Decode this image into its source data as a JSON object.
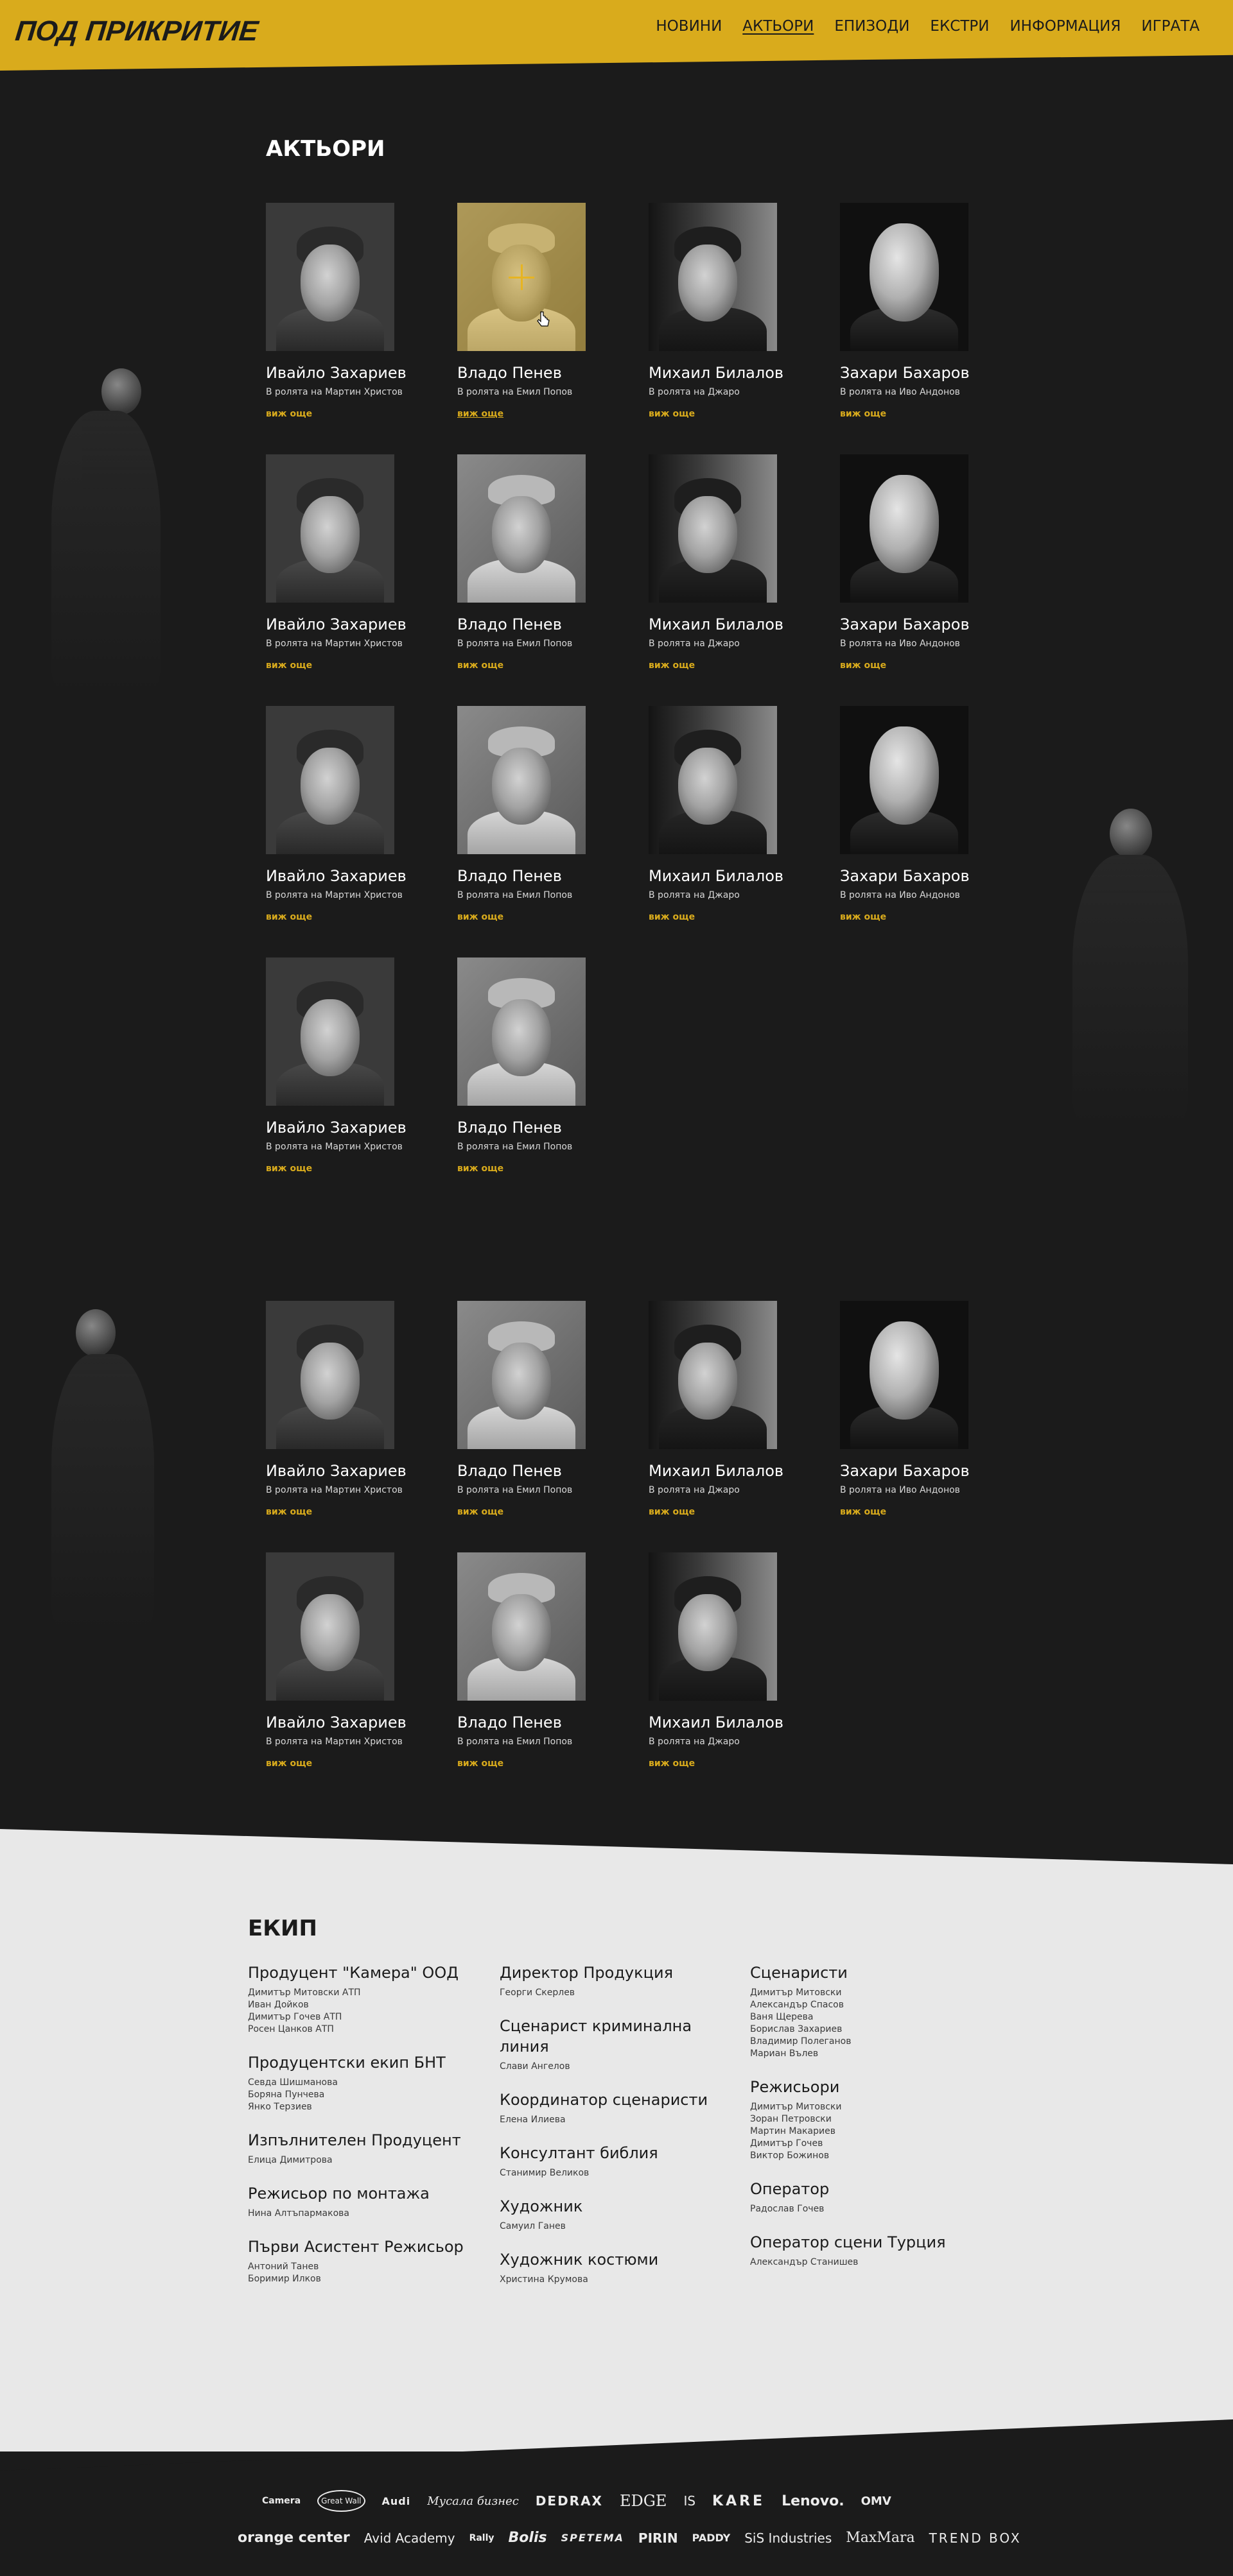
{
  "header": {
    "logo": "ПОД ПРИКРИТИЕ",
    "nav": [
      {
        "label": "НОВИНИ"
      },
      {
        "label": "АКТЬОРИ"
      },
      {
        "label": "ЕПИЗОДИ"
      },
      {
        "label": "ЕКСТРИ"
      },
      {
        "label": "ИНФОРМАЦИЯ"
      },
      {
        "label": "ИГРАТА"
      }
    ]
  },
  "actors_section": {
    "title": "АКТЬОРИ",
    "more_label": "виж още",
    "actors": [
      {
        "name": "Ивайло Захариев",
        "role": "В ролята на Мартин Христов"
      },
      {
        "name": "Владо Пенев",
        "role": "В ролята на Емил Попов"
      },
      {
        "name": "Михаил Билалов",
        "role": "В ролята на Джаро"
      },
      {
        "name": "Захари Бахаров",
        "role": "В ролята на Иво Андонов"
      }
    ]
  },
  "crew": {
    "title": "ЕКИП",
    "col1": [
      {
        "role": "Продуцент \"Камера\" ООД",
        "names": [
          "Димитър Митовски АТП",
          "Иван Дойков",
          "Димитър Гочев АТП",
          "Росен Цанков АТП"
        ]
      },
      {
        "role": "Продуцентски екип БНТ",
        "names": [
          "Севда Шишманова",
          "Боряна Пунчева",
          "Янко Терзиев"
        ]
      },
      {
        "role": "Изпълнителен Продуцент",
        "names": [
          "Елица Димитрова"
        ]
      },
      {
        "role": "Режисьор по монтажа",
        "names": [
          "Нина Алтъпармакова"
        ]
      },
      {
        "role": "Първи Асистент Режисьор",
        "names": [
          "Антоний Танев",
          "Боримир Илков"
        ]
      }
    ],
    "col2": [
      {
        "role": "Директор Продукция",
        "names": [
          "Георги Скерлев"
        ]
      },
      {
        "role": "Сценарист криминална линия",
        "names": [
          "Слави Ангелов"
        ]
      },
      {
        "role": "Координатор сценаристи",
        "names": [
          "Елена Илиева"
        ]
      },
      {
        "role": "Консултант библия",
        "names": [
          "Станимир Великов"
        ]
      },
      {
        "role": "Художник",
        "names": [
          "Самуил Ганев"
        ]
      },
      {
        "role": "Художник костюми",
        "names": [
          "Христина Крумова"
        ]
      }
    ],
    "col3": [
      {
        "role": "Сценаристи",
        "names": [
          "Димитър Митовски",
          "Александър Спасов",
          "Ваня Щерева",
          "Борислав Захариев",
          "Владимир Полеганов",
          "Мариан Вълев"
        ]
      },
      {
        "role": "Режисьори",
        "names": [
          "Димитър Митовски",
          "Зоран Петровски",
          "Мартин Макариев",
          "Димитър Гочев",
          "Виктор Божинов"
        ]
      },
      {
        "role": "Оператор",
        "names": [
          "Радослав Гочев"
        ]
      },
      {
        "role": "Оператор сцени Турция",
        "names": [
          "Александър Станишев"
        ]
      }
    ]
  },
  "sponsors": {
    "row1": [
      "Camera",
      "Great Wall",
      "Audi",
      "Мусала бизнес",
      "DEDRAX",
      "EDGE",
      "IS",
      "KARE",
      "Lenovo.",
      "OMV"
    ],
    "row2": [
      "orange center",
      "Avid Academy",
      "Rally",
      "Bolis",
      "SPETEMA",
      "PIRIN",
      "PADDY",
      "SiS Industries",
      "MaxMara",
      "TREND BOX"
    ]
  }
}
